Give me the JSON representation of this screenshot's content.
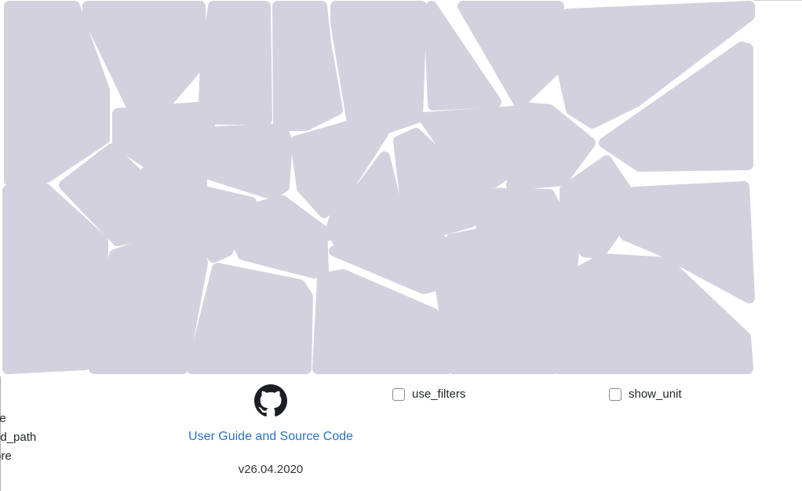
{
  "treemap": {
    "cell_color": "#d4d1de",
    "cell_count": 32
  },
  "left_options": [
    {
      "label": "de"
    },
    {
      "label": "id_path"
    },
    {
      "label": "ore"
    }
  ],
  "footer": {
    "github_icon": "github-icon",
    "guide_link": "User Guide and Source Code",
    "version": "v26.04.2020"
  },
  "controls": {
    "use_filters": {
      "label": "use_filters",
      "checked": false
    },
    "show_unit": {
      "label": "show_unit",
      "checked": false
    }
  }
}
